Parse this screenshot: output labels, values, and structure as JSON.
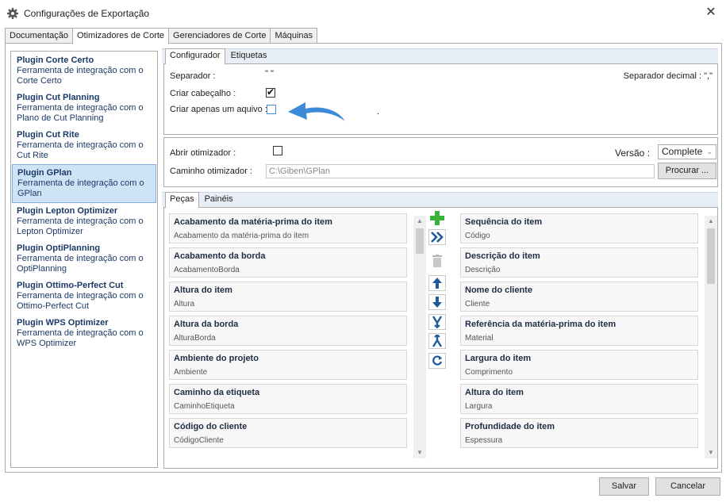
{
  "window": {
    "title": "Configurações de Exportação",
    "close_label": "✕"
  },
  "top_tabs": [
    {
      "label": "Documentação"
    },
    {
      "label": "Otimizadores de Corte"
    },
    {
      "label": "Gerenciadores de Corte"
    },
    {
      "label": "Máquinas"
    }
  ],
  "plugins": [
    {
      "name": "Plugin Corte Certo",
      "desc": "Ferramenta de integração com o Corte Certo"
    },
    {
      "name": "Plugin Cut Planning",
      "desc": "Ferramenta de integração com o Plano de Cut Planning"
    },
    {
      "name": "Plugin Cut Rite",
      "desc": "Ferramenta de integração com o Cut Rite"
    },
    {
      "name": "Plugin GPlan",
      "desc": "Ferramenta de integração com o GPlan"
    },
    {
      "name": "Plugin Lepton Optimizer",
      "desc": "Ferramenta de integração com o Lepton Optimizer"
    },
    {
      "name": "Plugin OptiPlanning",
      "desc": "Ferramenta de integração com o OptiPlanning"
    },
    {
      "name": "Plugin Ottimo-Perfect Cut",
      "desc": "Ferramenta de integração com o Ottimo-Perfect Cut"
    },
    {
      "name": "Plugin WPS Optimizer",
      "desc": "Ferramenta de integração com o WPS Optimizer"
    }
  ],
  "config_tabs": [
    {
      "label": "Configurador"
    },
    {
      "label": "Etiquetas"
    }
  ],
  "config": {
    "separator_label": "Separador :",
    "separator_value": "\" \"",
    "decimal_label": "Separador decimal : \",\"",
    "header_label": "Criar cabeçalho :",
    "single_file_label": "Criar apenas um aquivo :",
    "dot": "."
  },
  "optimizer": {
    "open_label": "Abrir otimizador :",
    "version_label": "Versão :",
    "version_value": "Complete",
    "path_label": "Caminho otimizador :",
    "path_value": "C:\\Giben\\GPlan",
    "browse_label": "Procurar ..."
  },
  "lower_tabs": [
    {
      "label": "Peças"
    },
    {
      "label": "Painéis"
    }
  ],
  "available_fields": [
    {
      "name": "Acabamento da matéria-prima do item",
      "sub": "Acabamento da matéria-prima do item"
    },
    {
      "name": "Acabamento da borda",
      "sub": "AcabamentoBorda"
    },
    {
      "name": "Altura do item",
      "sub": "Altura"
    },
    {
      "name": "Altura da borda",
      "sub": "AlturaBorda"
    },
    {
      "name": "Ambiente do projeto",
      "sub": "Ambiente"
    },
    {
      "name": "Caminho da etiqueta",
      "sub": "CaminhoEtiqueta"
    },
    {
      "name": "Código do cliente",
      "sub": "CódigoCliente"
    }
  ],
  "selected_fields": [
    {
      "name": "Sequência do item",
      "sub": "Código"
    },
    {
      "name": "Descrição do item",
      "sub": "Descrição"
    },
    {
      "name": "Nome do cliente",
      "sub": "Cliente"
    },
    {
      "name": "Referência da matéria-prima do item",
      "sub": "Material"
    },
    {
      "name": "Largura do item",
      "sub": "Comprimento"
    },
    {
      "name": "Altura do item",
      "sub": "Largura"
    },
    {
      "name": "Profundidade do item",
      "sub": "Espessura"
    }
  ],
  "footer": {
    "save_label": "Salvar",
    "cancel_label": "Cancelar"
  },
  "colors": {
    "accent": "#3c8ad8",
    "selection": "#cfe3f7",
    "add_green": "#3bb33b",
    "nav_blue": "#1d5b9c"
  }
}
